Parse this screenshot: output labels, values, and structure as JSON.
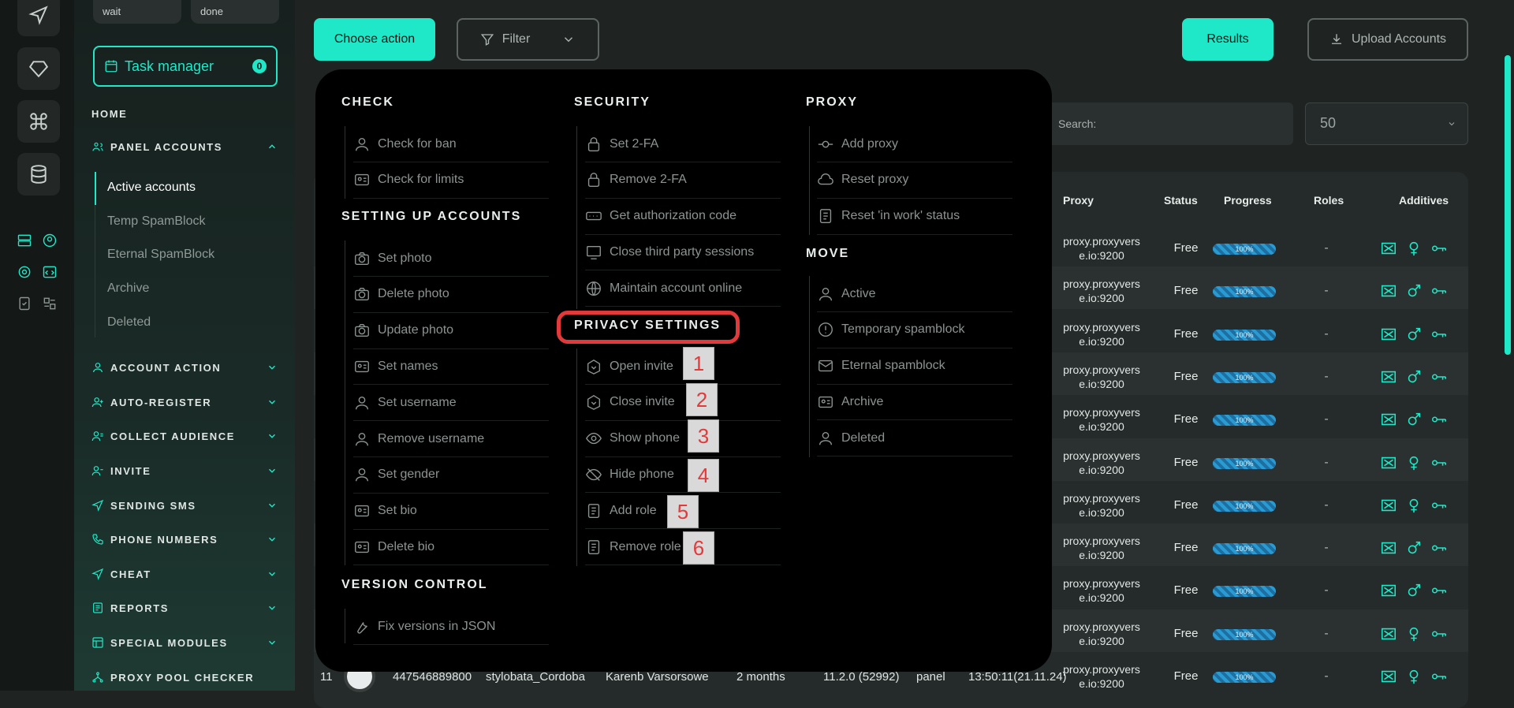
{
  "sidebar": {
    "chips": [
      "wait",
      "done"
    ],
    "task_manager": {
      "label": "Task manager",
      "count": "0"
    },
    "home": "HOME",
    "panel_accounts": "PANEL ACCOUNTS",
    "sub_items": [
      "Active accounts",
      "Temp SpamBlock",
      "Eternal SpamBlock",
      "Archive",
      "Deleted"
    ],
    "sections": [
      "ACCOUNT ACTION",
      "AUTO-REGISTER",
      "COLLECT AUDIENCE",
      "INVITE",
      "SENDING SMS",
      "PHONE NUMBERS",
      "CHEAT",
      "REPORTS",
      "SPECIAL MODULES",
      "PROXY POOL CHECKER"
    ]
  },
  "toolbar": {
    "choose_action": "Choose action",
    "filter": "Filter",
    "results": "Results",
    "upload": "Upload Accounts",
    "search_placeholder": "Search:",
    "per_page": "50"
  },
  "table": {
    "headers": {
      "proxy": "Proxy",
      "status": "Status",
      "progress": "Progress",
      "roles": "Roles",
      "additives": "Additives"
    },
    "rows": [
      {
        "proxy": [
          "proxy.proxyvers",
          "e.io:9200"
        ],
        "status": "Free",
        "progress": "100%",
        "roles": "-",
        "gender": "female"
      },
      {
        "proxy": [
          "proxy.proxyvers",
          "e.io:9200"
        ],
        "status": "Free",
        "progress": "100%",
        "roles": "-",
        "gender": "male"
      },
      {
        "proxy": [
          "proxy.proxyvers",
          "e.io:9200"
        ],
        "status": "Free",
        "progress": "100%",
        "roles": "-",
        "gender": "male"
      },
      {
        "proxy": [
          "proxy.proxyvers",
          "e.io:9200"
        ],
        "status": "Free",
        "progress": "100%",
        "roles": "-",
        "gender": "male"
      },
      {
        "proxy": [
          "proxy.proxyvers",
          "e.io:9200"
        ],
        "status": "Free",
        "progress": "100%",
        "roles": "-",
        "gender": "male"
      },
      {
        "proxy": [
          "proxy.proxyvers",
          "e.io:9200"
        ],
        "status": "Free",
        "progress": "100%",
        "roles": "-",
        "gender": "female"
      },
      {
        "proxy": [
          "proxy.proxyvers",
          "e.io:9200"
        ],
        "status": "Free",
        "progress": "100%",
        "roles": "-",
        "gender": "female"
      },
      {
        "proxy": [
          "proxy.proxyvers",
          "e.io:9200"
        ],
        "status": "Free",
        "progress": "100%",
        "roles": "-",
        "gender": "male"
      },
      {
        "proxy": [
          "proxy.proxyvers",
          "e.io:9200"
        ],
        "status": "Free",
        "progress": "100%",
        "roles": "-",
        "gender": "male"
      },
      {
        "proxy": [
          "proxy.proxyvers",
          "e.io:9200"
        ],
        "status": "Free",
        "progress": "100%",
        "roles": "-",
        "gender": "female"
      },
      {
        "proxy": [
          "proxy.proxyvers",
          "e.io:9200"
        ],
        "status": "Free",
        "progress": "100%",
        "roles": "-",
        "gender": "female"
      }
    ],
    "last_row": {
      "num": "11",
      "phone": "447546889800",
      "username": "stylobata_Cordoba",
      "name": "Karenb Varsorsowe",
      "age": "2 months",
      "version": "11.2.0 (52992)",
      "source": "panel",
      "time": "13:50:11(21.11.24)"
    }
  },
  "menu": {
    "check": {
      "title": "CHECK",
      "items": [
        "Check for ban",
        "Check for limits"
      ]
    },
    "setup": {
      "title": "SETTING UP ACCOUNTS",
      "items": [
        "Set photo",
        "Delete photo",
        "Update photo",
        "Set names",
        "Set username",
        "Remove username",
        "Set gender",
        "Set bio",
        "Delete bio"
      ]
    },
    "version": {
      "title": "VERSION CONTROL",
      "items": [
        "Fix versions in JSON"
      ]
    },
    "security": {
      "title": "SECURITY",
      "items": [
        "Set 2-FA",
        "Remove 2-FA",
        "Get authorization code",
        "Close third party sessions",
        "Maintain account online"
      ]
    },
    "privacy": {
      "title": "PRIVACY SETTINGS",
      "items": [
        "Open invite",
        "Close invite",
        "Show phone",
        "Hide phone",
        "Add role",
        "Remove role"
      ]
    },
    "proxy": {
      "title": "PROXY",
      "items": [
        "Add proxy",
        "Reset proxy",
        "Reset 'in work' status"
      ]
    },
    "move": {
      "title": "MOVE",
      "items": [
        "Active",
        "Temporary spamblock",
        "Eternal spamblock",
        "Archive",
        "Deleted"
      ]
    }
  },
  "annotations": [
    "1",
    "2",
    "3",
    "4",
    "5",
    "6"
  ],
  "colors": {
    "accent": "#1ee8c7",
    "highlight": "#e23a3a",
    "menu_bg": "#000000"
  }
}
